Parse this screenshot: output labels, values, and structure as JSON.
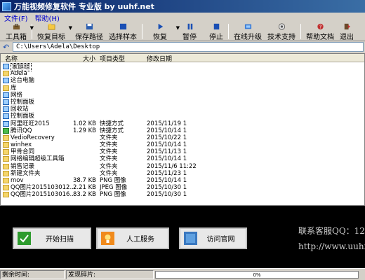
{
  "title": "万能视频修复软件 专业版 by uuhf.net",
  "menu": [
    "文件(F)",
    "帮助(H)"
  ],
  "toolbar": {
    "tools": "工具箱",
    "restore_target": "恢复目标",
    "save_path": "保存路径",
    "select_sample": "选择样本",
    "recover": "恢复",
    "pause": "暂停",
    "stop": "停止",
    "online_upgrade": "在线升级",
    "tech_support": "技术支持",
    "help_docs": "帮助文档",
    "exit": "退出"
  },
  "path": "C:\\Users\\Adela\\Desktop",
  "columns": {
    "name": "名称",
    "size": "大小",
    "type": "项目类型",
    "date": "修改日期"
  },
  "rows": [
    {
      "icon": "homegroup-icon",
      "name": "家庭组",
      "size": "",
      "type": "",
      "date": ""
    },
    {
      "icon": "user-folder-icon",
      "name": "Adela",
      "size": "",
      "type": "",
      "date": ""
    },
    {
      "icon": "computer-icon",
      "name": "这台电脑",
      "size": "",
      "type": "",
      "date": ""
    },
    {
      "icon": "library-icon",
      "name": "库",
      "size": "",
      "type": "",
      "date": ""
    },
    {
      "icon": "network-icon",
      "name": "网络",
      "size": "",
      "type": "",
      "date": ""
    },
    {
      "icon": "control-panel-icon",
      "name": "控制面板",
      "size": "",
      "type": "",
      "date": ""
    },
    {
      "icon": "recycle-bin-icon",
      "name": "回收站",
      "size": "",
      "type": "",
      "date": ""
    },
    {
      "icon": "control-panel-icon",
      "name": "控制面板",
      "size": "",
      "type": "",
      "date": ""
    },
    {
      "icon": "app-shortcut-icon",
      "name": "阿里旺旺2015",
      "size": "1.02 KB",
      "type": "快捷方式",
      "date": "2015/11/19 1"
    },
    {
      "icon": "qq-shortcut-icon",
      "name": "腾讯QQ",
      "size": "1.29 KB",
      "type": "快捷方式",
      "date": "2015/10/14 1"
    },
    {
      "icon": "folder-icon",
      "name": "VedioRecovery",
      "size": "",
      "type": "文件夹",
      "date": "2015/10/22 1"
    },
    {
      "icon": "folder-icon",
      "name": "winhex",
      "size": "",
      "type": "文件夹",
      "date": "2015/10/14 1"
    },
    {
      "icon": "folder-icon",
      "name": "甲骨合同",
      "size": "",
      "type": "文件夹",
      "date": "2015/11/13 1"
    },
    {
      "icon": "folder-icon",
      "name": "网络编辑超级工具箱",
      "size": "",
      "type": "文件夹",
      "date": "2015/10/14 1"
    },
    {
      "icon": "folder-icon",
      "name": "销售记录",
      "size": "",
      "type": "文件夹",
      "date": "2015/11/6 11:22"
    },
    {
      "icon": "folder-icon",
      "name": "新建文件夹",
      "size": "",
      "type": "文件夹",
      "date": "2015/11/23 1"
    },
    {
      "icon": "image-icon",
      "name": "mov",
      "size": "38.7 KB",
      "type": "PNG 图像",
      "date": "2015/10/14 1"
    },
    {
      "icon": "image-icon",
      "name": "QQ图片2015103012...",
      "size": "2.21 KB",
      "type": "JPEG 图像",
      "date": "2015/10/30 1"
    },
    {
      "icon": "image-icon",
      "name": "QQ图片2015103016...",
      "size": "83.2 KB",
      "type": "PNG 图像",
      "date": "2015/10/30 1"
    }
  ],
  "actions": {
    "scan": "开始扫描",
    "manual": "人工服务",
    "visit": "访问官网"
  },
  "contact": {
    "qq": "联系客服QQ：12",
    "url": "http://www.uuhf"
  },
  "status": {
    "remaining": "剩余时间:",
    "found": "发现碎片:",
    "progress_text": "0%",
    "progress_value": 0
  }
}
